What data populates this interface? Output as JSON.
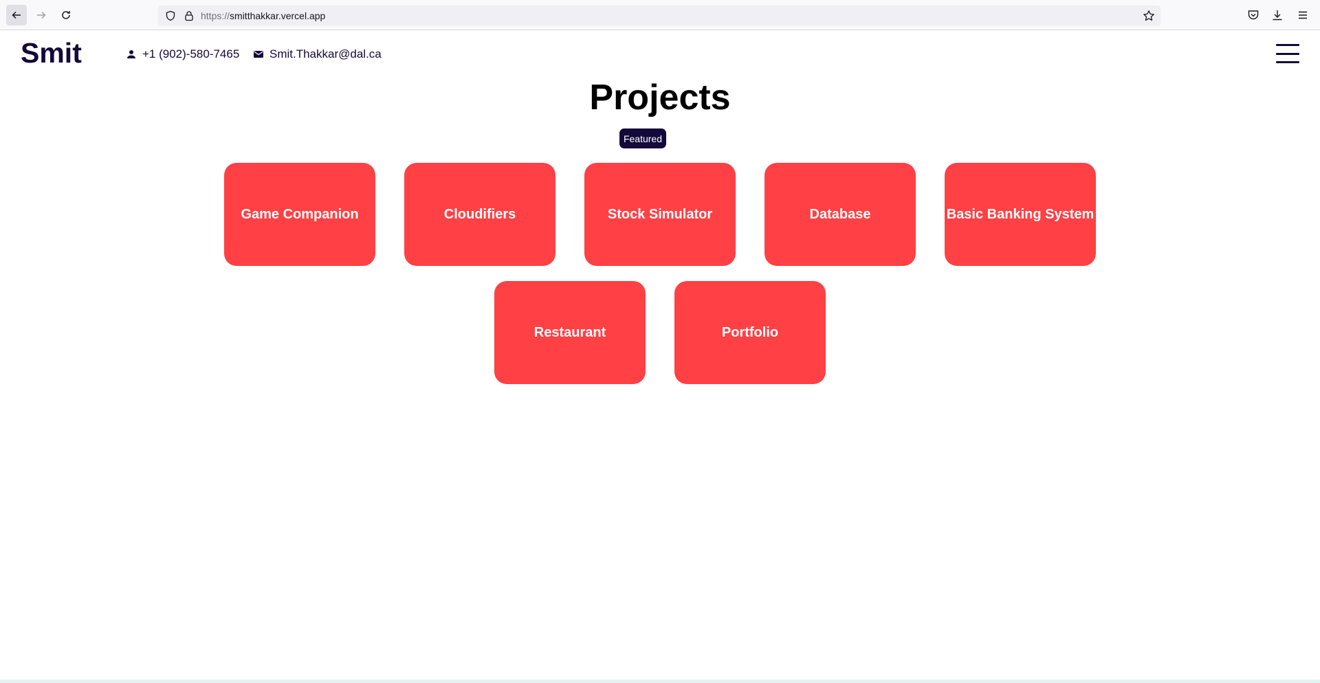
{
  "browser": {
    "url_protocol": "https://",
    "url_host": "smitthakkar.vercel.app"
  },
  "header": {
    "brand": "Smit",
    "phone": "+1 (902)-580-7465",
    "email": "Smit.Thakkar@dal.ca"
  },
  "main": {
    "title": "Projects",
    "badge": "Featured",
    "projects": [
      {
        "label": "Game Companion"
      },
      {
        "label": "Cloudifiers"
      },
      {
        "label": "Stock Simulator"
      },
      {
        "label": "Database"
      },
      {
        "label": "Basic Banking System"
      },
      {
        "label": "Restaurant"
      },
      {
        "label": "Portfolio"
      }
    ]
  },
  "colors": {
    "card": "#ff4044",
    "brand": "#14093a",
    "badge_bg": "#14093a"
  },
  "icons": [
    "back-icon",
    "forward-icon",
    "reload-icon",
    "shield-icon",
    "lock-icon",
    "bookmark-star-icon",
    "pocket-icon",
    "download-icon",
    "app-menu-icon",
    "person-icon",
    "mail-icon",
    "hamburger-icon"
  ]
}
